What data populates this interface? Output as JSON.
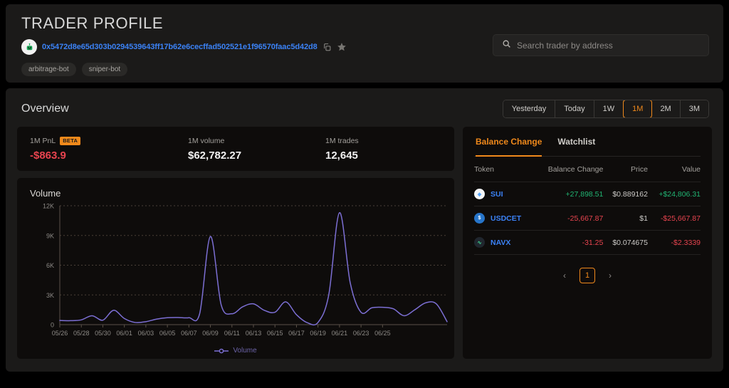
{
  "header": {
    "title": "TRADER PROFILE",
    "address": "0x5472d8e65d303b0294539643ff17b62e6cecffad502521e1f96570faac5d42d8",
    "avatar_icon": "robot-icon",
    "copy_icon": "copy-icon",
    "star_icon": "star-icon",
    "tags": [
      "arbitrage-bot",
      "sniper-bot"
    ],
    "search": {
      "placeholder": "Search trader by address",
      "value": "",
      "icon": "search-icon"
    }
  },
  "overview": {
    "title": "Overview",
    "ranges": [
      {
        "label": "Yesterday",
        "active": false
      },
      {
        "label": "Today",
        "active": false
      },
      {
        "label": "1W",
        "active": false
      },
      {
        "label": "1M",
        "active": true
      },
      {
        "label": "2M",
        "active": false
      },
      {
        "label": "3M",
        "active": false
      }
    ],
    "accent": "#f0891b"
  },
  "stats": [
    {
      "label": "1M PnL",
      "badge": "BETA",
      "value": "-$863.9",
      "negative": true
    },
    {
      "label": "1M volume",
      "badge": "",
      "value": "$62,782.27",
      "negative": false
    },
    {
      "label": "1M trades",
      "badge": "",
      "value": "12,645",
      "negative": false
    }
  ],
  "chart_data": {
    "type": "line",
    "title": "Volume",
    "xlabel": "",
    "ylabel": "",
    "legend": [
      "Volume"
    ],
    "legend_position": "bottom-center",
    "grid": true,
    "line_color": "#7c6fd4",
    "ylim": [
      0,
      12000
    ],
    "yticks": [
      0,
      3000,
      6000,
      9000,
      12000
    ],
    "ytick_labels": [
      "0",
      "3K",
      "6K",
      "9K",
      "12K"
    ],
    "xtick_labels": [
      "05/26",
      "05/28",
      "05/30",
      "06/01",
      "06/03",
      "06/05",
      "06/07",
      "06/09",
      "06/11",
      "06/13",
      "06/15",
      "06/17",
      "06/19",
      "06/21",
      "06/23",
      "06/25"
    ],
    "x": [
      "05/26",
      "05/27",
      "05/28",
      "05/29",
      "05/30",
      "05/31",
      "06/01",
      "06/02",
      "06/03",
      "06/04",
      "06/05",
      "06/06",
      "06/07",
      "06/08",
      "06/09",
      "06/10",
      "06/11",
      "06/12",
      "06/13",
      "06/14",
      "06/15",
      "06/16",
      "06/17",
      "06/18",
      "06/19",
      "06/20",
      "06/21",
      "06/22",
      "06/23",
      "06/24",
      "06/25"
    ],
    "series": [
      {
        "name": "Volume",
        "values": [
          420,
          400,
          480,
          900,
          450,
          1450,
          620,
          220,
          300,
          560,
          700,
          720,
          700,
          1100,
          8900,
          2000,
          1100,
          1800,
          2100,
          1450,
          1250,
          2300,
          1000,
          200,
          220,
          3000,
          11300,
          4200,
          1250,
          1700,
          1750,
          1600,
          900,
          1500,
          2200,
          2100,
          300
        ]
      }
    ]
  },
  "balance_panel": {
    "tabs": [
      {
        "label": "Balance Change",
        "active": true
      },
      {
        "label": "Watchlist",
        "active": false
      }
    ],
    "columns": [
      "Token",
      "Balance Change",
      "Price",
      "Value"
    ],
    "rows": [
      {
        "token": "SUI",
        "icon": "sui-token-icon",
        "icon_bg": "#f4f6f8",
        "icon_fg": "#4da2ff",
        "balance_change": "+27,898.51",
        "balance_sign": "pos",
        "price": "$0.889162",
        "value": "+$24,806.31",
        "value_sign": "pos"
      },
      {
        "token": "USDCET",
        "icon": "usdcet-token-icon",
        "icon_bg": "#2775ca",
        "icon_fg": "#ffffff",
        "balance_change": "-25,667.87",
        "balance_sign": "neg",
        "price": "$1",
        "value": "-$25,667.87",
        "value_sign": "neg"
      },
      {
        "token": "NAVX",
        "icon": "navx-token-icon",
        "icon_bg": "#20262e",
        "icon_fg": "#3ddc97",
        "balance_change": "-31.25",
        "balance_sign": "neg",
        "price": "$0.074675",
        "value": "-$2.3339",
        "value_sign": "neg"
      }
    ],
    "pagination": {
      "prev_icon": "chevron-left-icon",
      "next_icon": "chevron-right-icon",
      "current_page": "1"
    }
  }
}
